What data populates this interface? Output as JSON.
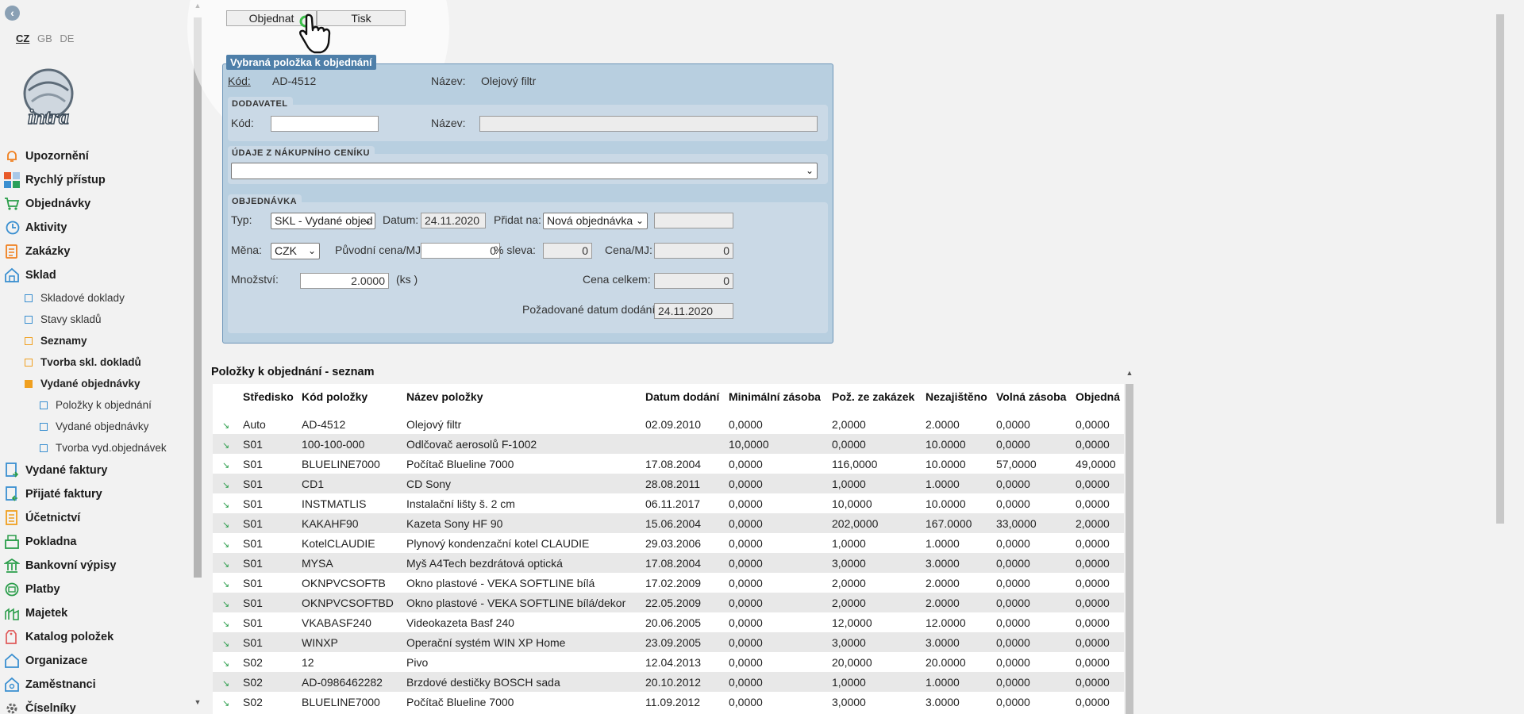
{
  "sidebar": {
    "back_symbol": "‹",
    "languages": [
      "CZ",
      "GB",
      "DE"
    ],
    "logo_text": "intra",
    "items": [
      {
        "label": "Upozornění",
        "icon": "bell-icon"
      },
      {
        "label": "Rychlý přístup",
        "icon": "tiles-icon"
      },
      {
        "label": "Objednávky",
        "icon": "cart-icon"
      },
      {
        "label": "Aktivity",
        "icon": "clock-icon"
      },
      {
        "label": "Zakázky",
        "icon": "clipboard-icon"
      },
      {
        "label": "Sklad",
        "icon": "warehouse-icon"
      }
    ],
    "sklad_children": [
      {
        "label": "Skladové doklady"
      },
      {
        "label": "Stavy skladů"
      },
      {
        "label": "Seznamy"
      },
      {
        "label": "Tvorba skl. dokladů"
      },
      {
        "label": "Vydané objednávky"
      }
    ],
    "vydane_children": [
      {
        "label": "Položky k objednání"
      },
      {
        "label": "Vydané objednávky"
      },
      {
        "label": "Tvorba vyd.objednávek"
      }
    ],
    "items_after": [
      {
        "label": "Vydané faktury",
        "icon": "invoice-out-icon"
      },
      {
        "label": "Přijaté faktury",
        "icon": "invoice-in-icon"
      },
      {
        "label": "Účetnictví",
        "icon": "ledger-icon"
      },
      {
        "label": "Pokladna",
        "icon": "cashbox-icon"
      },
      {
        "label": "Bankovní výpisy",
        "icon": "bank-icon"
      },
      {
        "label": "Platby",
        "icon": "payments-icon"
      },
      {
        "label": "Majetek",
        "icon": "assets-icon"
      },
      {
        "label": "Katalog položek",
        "icon": "tag-icon"
      },
      {
        "label": "Organizace",
        "icon": "organization-icon"
      },
      {
        "label": "Zaměstnanci",
        "icon": "employees-icon"
      },
      {
        "label": "Číselníky",
        "icon": "gear-icon"
      }
    ]
  },
  "toolbar": {
    "order_label": "Objednat",
    "print_label": "Tisk"
  },
  "panel": {
    "title": "Vybraná položka k objednání",
    "kod_label": "Kód:",
    "kod_value": "AD-4512",
    "nazev_label": "Název:",
    "nazev_value": "Olejový filtr",
    "dodavatel": {
      "title": "DODAVATEL",
      "kod_label": "Kód:",
      "kod_value": "",
      "nazev_label": "Název:",
      "nazev_value": ""
    },
    "cenik": {
      "title": "ÚDAJE Z NÁKUPNÍHO CENÍKU",
      "value": ""
    },
    "objednavka": {
      "title": "OBJEDNÁVKA",
      "typ_label": "Typ:",
      "typ_value": "SKL - Vydané objed",
      "datum_label": "Datum:",
      "datum_value": "24.11.2020",
      "pridat_label": "Přidat na:",
      "pridat_value": "Nová objednávka",
      "pridat_extra": "",
      "mena_label": "Měna:",
      "mena_value": "CZK",
      "puvodni_label": "Původní cena/MJ:",
      "puvodni_value": "0",
      "sleva_label": "% sleva:",
      "sleva_value": "0",
      "cena_mj_label": "Cena/MJ:",
      "cena_mj_value": "0",
      "mnozstvi_label": "Množství:",
      "mnozstvi_value": "2.0000",
      "unit": "(ks )",
      "cena_celkem_label": "Cena celkem:",
      "cena_celkem_value": "0",
      "pozad_label": "Požadované datum dodání:",
      "pozad_value": "24.11.2020"
    }
  },
  "list": {
    "title": "Položky k objednání - seznam",
    "columns": [
      "Středisko",
      "Kód položky",
      "Název položky",
      "Datum dodání",
      "Minimální zásoba",
      "Pož. ze zakázek",
      "Nezajištěno",
      "Volná zásoba",
      "Objedná"
    ],
    "rows": [
      [
        "Auto",
        "AD-4512",
        "Olejový filtr",
        "02.09.2010",
        "0,0000",
        "2,0000",
        "2.0000",
        "0,0000",
        "0,0000"
      ],
      [
        "S01",
        "100-100-000",
        "Odlčovač aerosolů F-1002",
        "",
        "10,0000",
        "0,0000",
        "10.0000",
        "0,0000",
        "0,0000"
      ],
      [
        "S01",
        "BLUELINE7000",
        "Počítač Blueline 7000",
        "17.08.2004",
        "0,0000",
        "116,0000",
        "10.0000",
        "57,0000",
        "49,0000"
      ],
      [
        "S01",
        "CD1",
        "CD Sony",
        "28.08.2011",
        "0,0000",
        "1,0000",
        "1.0000",
        "0,0000",
        "0,0000"
      ],
      [
        "S01",
        "INSTMATLIS",
        "Instalační lišty š. 2 cm",
        "06.11.2017",
        "0,0000",
        "10,0000",
        "10.0000",
        "0,0000",
        "0,0000"
      ],
      [
        "S01",
        "KAKAHF90",
        "Kazeta Sony HF 90",
        "15.06.2004",
        "0,0000",
        "202,0000",
        "167.0000",
        "33,0000",
        "2,0000"
      ],
      [
        "S01",
        "KotelCLAUDIE",
        "Plynový kondenzační kotel CLAUDIE",
        "29.03.2006",
        "0,0000",
        "1,0000",
        "1.0000",
        "0,0000",
        "0,0000"
      ],
      [
        "S01",
        "MYSA",
        "Myš A4Tech bezdrátová optická",
        "17.08.2004",
        "0,0000",
        "3,0000",
        "3.0000",
        "0,0000",
        "0,0000"
      ],
      [
        "S01",
        "OKNPVCSOFTB",
        "Okno plastové - VEKA SOFTLINE bílá",
        "17.02.2009",
        "0,0000",
        "2,0000",
        "2.0000",
        "0,0000",
        "0,0000"
      ],
      [
        "S01",
        "OKNPVCSOFTBD",
        "Okno plastové - VEKA SOFTLINE bílá/dekor",
        "22.05.2009",
        "0,0000",
        "2,0000",
        "2.0000",
        "0,0000",
        "0,0000"
      ],
      [
        "S01",
        "VKABASF240",
        "Videokazeta Basf 240",
        "20.06.2005",
        "0,0000",
        "12,0000",
        "12.0000",
        "0,0000",
        "0,0000"
      ],
      [
        "S01",
        "WINXP",
        "Operační systém WIN XP Home",
        "23.09.2005",
        "0,0000",
        "3,0000",
        "3.0000",
        "0,0000",
        "0,0000"
      ],
      [
        "S02",
        "12",
        "Pivo",
        "12.04.2013",
        "0,0000",
        "20,0000",
        "20.0000",
        "0,0000",
        "0,0000"
      ],
      [
        "S02",
        "AD-0986462282",
        "Brzdové destičky BOSCH sada",
        "20.10.2012",
        "0,0000",
        "1,0000",
        "1.0000",
        "0,0000",
        "0,0000"
      ],
      [
        "S02",
        "BLUELINE7000",
        "Počítač Blueline 7000",
        "11.09.2012",
        "0,0000",
        "3,0000",
        "3.0000",
        "0,0000",
        "0,0000"
      ]
    ]
  },
  "colors": {
    "panel_bg": "#b8cfe0",
    "panel_border": "#6e95b8",
    "panel_title_bg": "#4e7fa9",
    "section_bg": "#cad9e6",
    "row_alt": "#e8e8e8"
  }
}
